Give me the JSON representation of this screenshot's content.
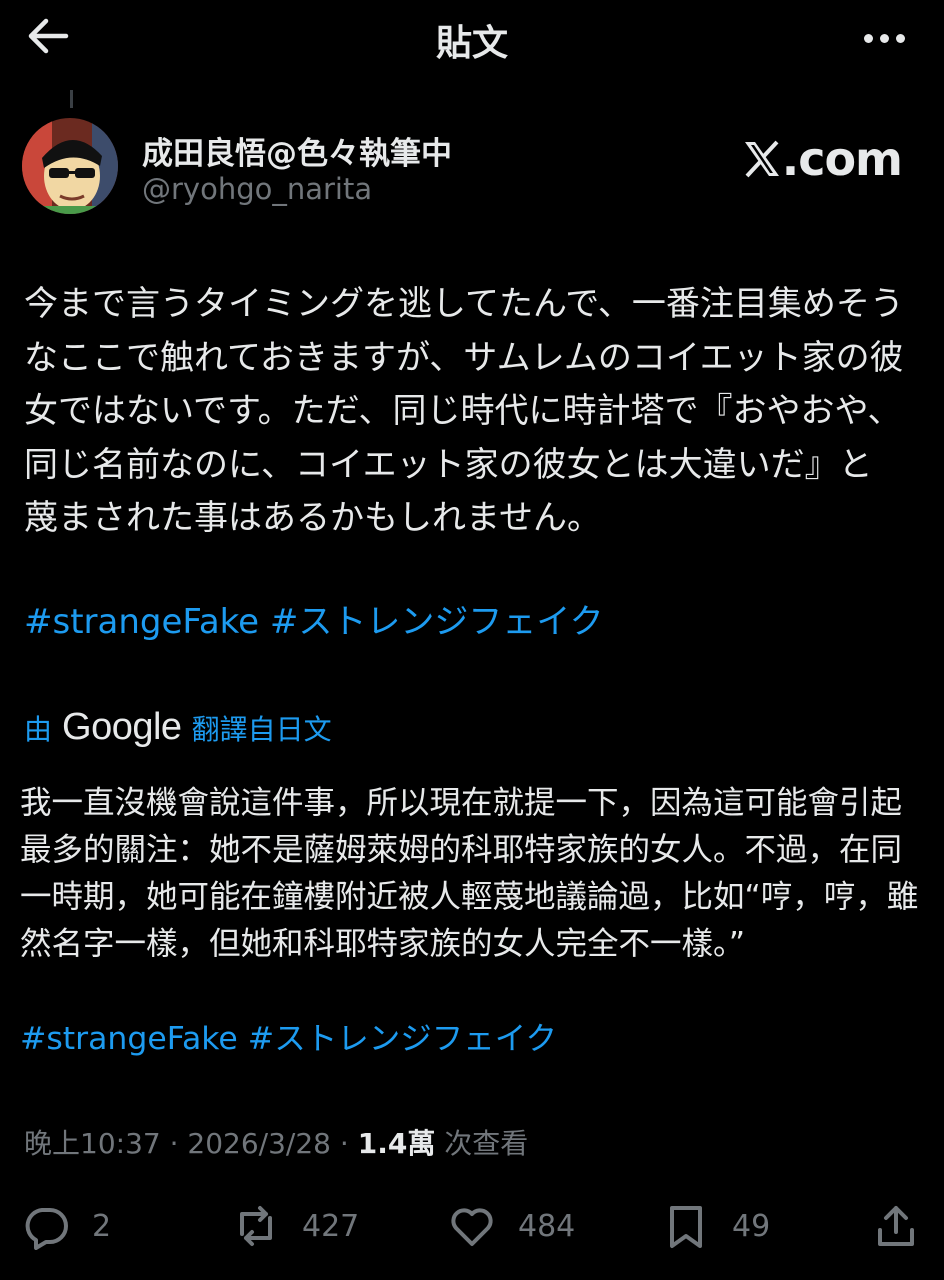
{
  "header": {
    "title": "貼文"
  },
  "author": {
    "display_name": "成田良悟@色々執筆中",
    "handle": "@ryohgo_narita",
    "site_badge": "com"
  },
  "post": {
    "original_text": "今まで言うタイミングを逃してたんで、一番注目集めそうなここで触れておきますが、サムレムのコイエット家の彼女ではないです。ただ、同じ時代に時計塔で『おやおや、同じ名前なのに、コイエット家の彼女とは大違いだ』と蔑まされた事はあるかもしれません。",
    "original_hashtags": [
      "#strangeFake",
      "#ストレンジフェイク"
    ],
    "translation_prefix": "由",
    "translation_provider": "Google",
    "translation_suffix": "翻譯自日文",
    "translated_text": "我一直沒機會說這件事，所以現在就提一下，因為這可能會引起最多的關注：她不是薩姆萊姆的科耶特家族的女人。不過，在同一時期，她可能在鐘樓附近被人輕蔑地議論過，比如“哼，哼，雖然名字一樣，但她和科耶特家族的女人完全不一樣。”",
    "translated_hashtags": [
      "#strangeFake",
      "#ストレンジフェイク"
    ]
  },
  "meta": {
    "time": "晚上10:37",
    "date": "2026/3/28",
    "views": "1.4萬",
    "views_label": "次查看"
  },
  "actions": {
    "replies": "2",
    "reposts": "427",
    "likes": "484",
    "bookmarks": "49"
  },
  "colors": {
    "accent": "#1d9bf0",
    "background": "#000000",
    "muted": "#71767b"
  },
  "icons": [
    "back-arrow-icon",
    "more-icon",
    "x-logo-icon",
    "reply-icon",
    "repost-icon",
    "like-icon",
    "bookmark-icon",
    "share-icon"
  ]
}
